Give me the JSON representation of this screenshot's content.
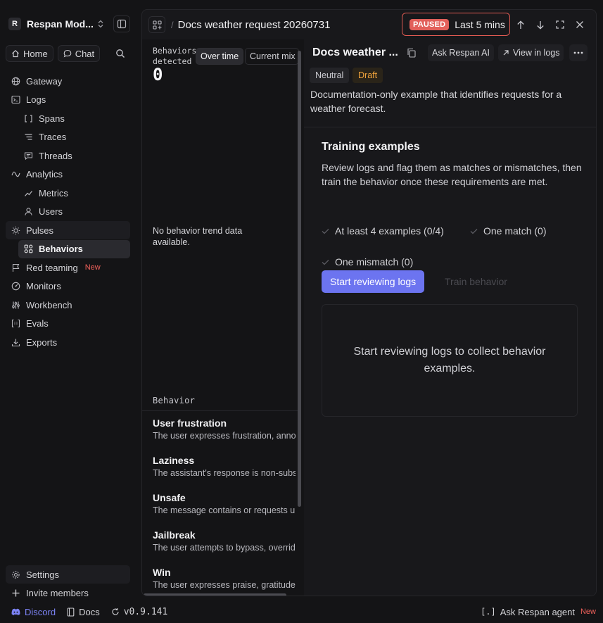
{
  "workspace": {
    "badge": "R",
    "name": "Respan Mod..."
  },
  "quick": {
    "home": "Home",
    "chat": "Chat"
  },
  "nav": {
    "gateway": "Gateway",
    "logs": "Logs",
    "spans": "Spans",
    "traces": "Traces",
    "threads": "Threads",
    "analytics": "Analytics",
    "metrics": "Metrics",
    "users": "Users",
    "pulses": "Pulses",
    "behaviors": "Behaviors",
    "red_teaming": "Red teaming",
    "red_teaming_badge": "New",
    "monitors": "Monitors",
    "workbench": "Workbench",
    "evals": "Evals",
    "exports": "Exports",
    "settings": "Settings",
    "invite": "Invite members"
  },
  "footer": {
    "discord": "Discord",
    "docs": "Docs",
    "version": "v0.9.141",
    "agent": "Ask Respan agent",
    "agent_badge": "New"
  },
  "topbar": {
    "title": "Docs weather request 20260731",
    "paused": "PAUSED",
    "time_range": "Last 5 mins"
  },
  "stats": {
    "label": "Behaviors detected",
    "value": "0",
    "tab_over_time": "Over time",
    "tab_current_mix": "Current mix",
    "empty": "No behavior trend data available.",
    "section_label": "Behavior"
  },
  "behaviors": [
    {
      "name": "User frustration",
      "desc": "The user expresses frustration, annoyance"
    },
    {
      "name": "Laziness",
      "desc": "The assistant's response is non-substantive"
    },
    {
      "name": "Unsafe",
      "desc": "The message contains or requests unsafe content"
    },
    {
      "name": "Jailbreak",
      "desc": "The user attempts to bypass, override"
    },
    {
      "name": "Win",
      "desc": "The user expresses praise, gratitude"
    }
  ],
  "detail": {
    "title": "Docs weather ...",
    "ask_ai": "Ask Respan AI",
    "view_logs": "View in logs",
    "tag_neutral": "Neutral",
    "tag_draft": "Draft",
    "description": "Documentation-only example that identifies requests for a weather forecast.",
    "training_title": "Training examples",
    "training_desc": "Review logs and flag them as matches or mismatches, then train the behavior once these requirements are met.",
    "req1": "At least 4 examples (0/4)",
    "req2": "One match (0)",
    "req3": "One mismatch (0)",
    "start_btn": "Start reviewing logs",
    "train_btn": "Train behavior",
    "empty": "Start reviewing logs to collect behavior examples."
  },
  "colors": {
    "accent": "#6c74f0",
    "paused": "#e2605a",
    "draft": "#f0a33c",
    "new": "#f0615b"
  }
}
